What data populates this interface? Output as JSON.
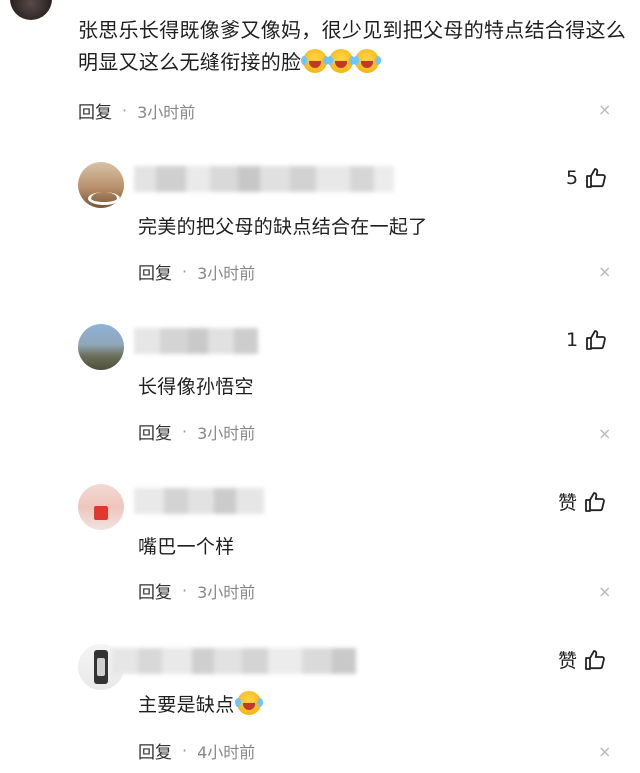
{
  "main_comment": {
    "text": "张思乐长得既像爹又像妈，很少见到把父母的特点结合得这么明显又这么无缝衔接的脸",
    "emojis": [
      "laugh-cry-emoji",
      "laugh-cry-emoji",
      "laugh-cry-emoji"
    ],
    "reply_label": "回复",
    "separator": "·",
    "time": "3小时前",
    "close_icon": "×"
  },
  "replies": [
    {
      "text": "完美的把父母的缺点结合在一起了",
      "reply_label": "回复",
      "separator": "·",
      "time": "3小时前",
      "likes": "5",
      "close_icon": "×"
    },
    {
      "text": "长得像孙悟空",
      "reply_label": "回复",
      "separator": "·",
      "time": "3小时前",
      "likes": "1",
      "close_icon": "×"
    },
    {
      "text": "嘴巴一个样",
      "reply_label": "回复",
      "separator": "·",
      "time": "3小时前",
      "likes": "赞",
      "close_icon": "×"
    },
    {
      "text": "主要是缺点",
      "reply_label": "回复",
      "separator": "·",
      "time": "4小时前",
      "likes": "赞",
      "close_icon": "×"
    }
  ],
  "colors": {
    "text": "#1f1f1f",
    "muted": "#888888",
    "close": "#b8b8b8",
    "background": "#ffffff"
  },
  "icons": [
    "thumbs-up-icon",
    "close-icon",
    "avatar"
  ]
}
